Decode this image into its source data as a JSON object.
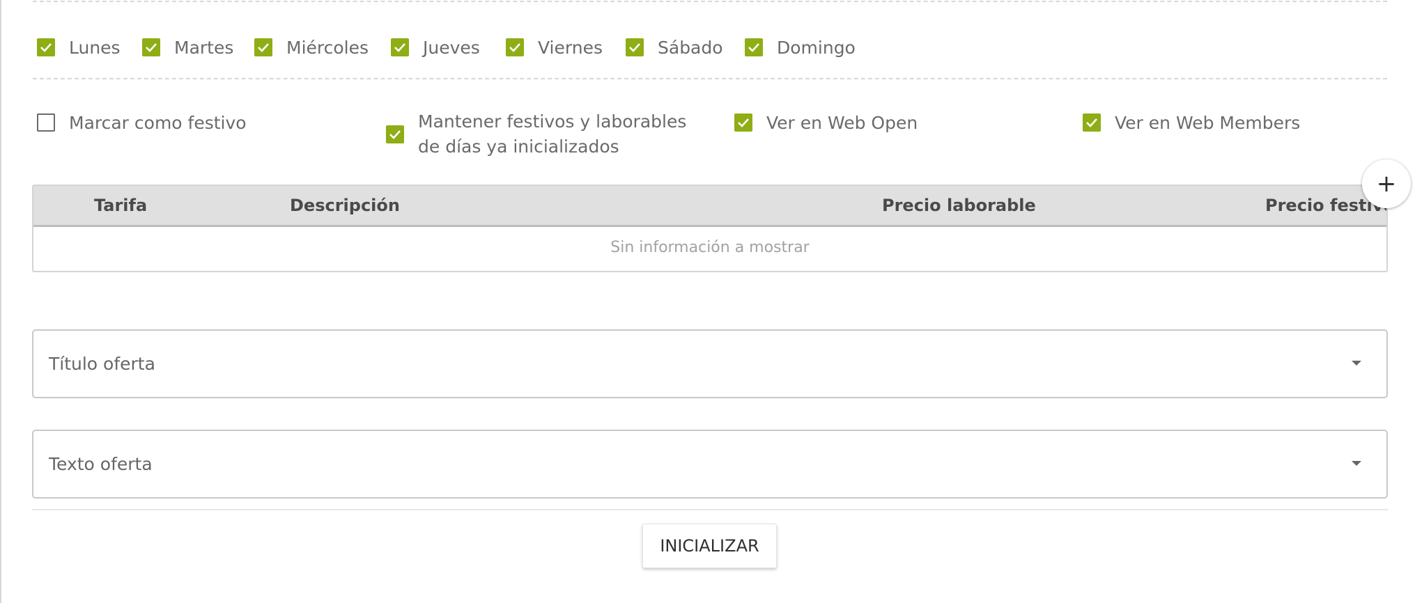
{
  "days": [
    {
      "label": "Lunes",
      "checked": true
    },
    {
      "label": "Martes",
      "checked": true
    },
    {
      "label": "Miércoles",
      "checked": true
    },
    {
      "label": "Jueves",
      "checked": true
    },
    {
      "label": "Viernes",
      "checked": true
    },
    {
      "label": "Sábado",
      "checked": true
    },
    {
      "label": "Domingo",
      "checked": true
    }
  ],
  "options": {
    "holiday": {
      "label": "Marcar como festivo",
      "checked": false
    },
    "keep": {
      "label": "Mantener festivos y laborables de días ya inicializados",
      "checked": true
    },
    "web_open": {
      "label": "Ver en Web Open",
      "checked": true
    },
    "web_members": {
      "label": "Ver en Web Members",
      "checked": true
    }
  },
  "table": {
    "columns": [
      "Tarifa",
      "Descripción",
      "Precio laborable",
      "Precio festivo"
    ],
    "empty_message": "Sin información a mostrar",
    "add_label": "+"
  },
  "offer_title": {
    "placeholder": "Título oferta"
  },
  "offer_text": {
    "placeholder": "Texto oferta"
  },
  "init_button": "INICIALIZAR",
  "colors": {
    "accent": "#8fad15"
  }
}
